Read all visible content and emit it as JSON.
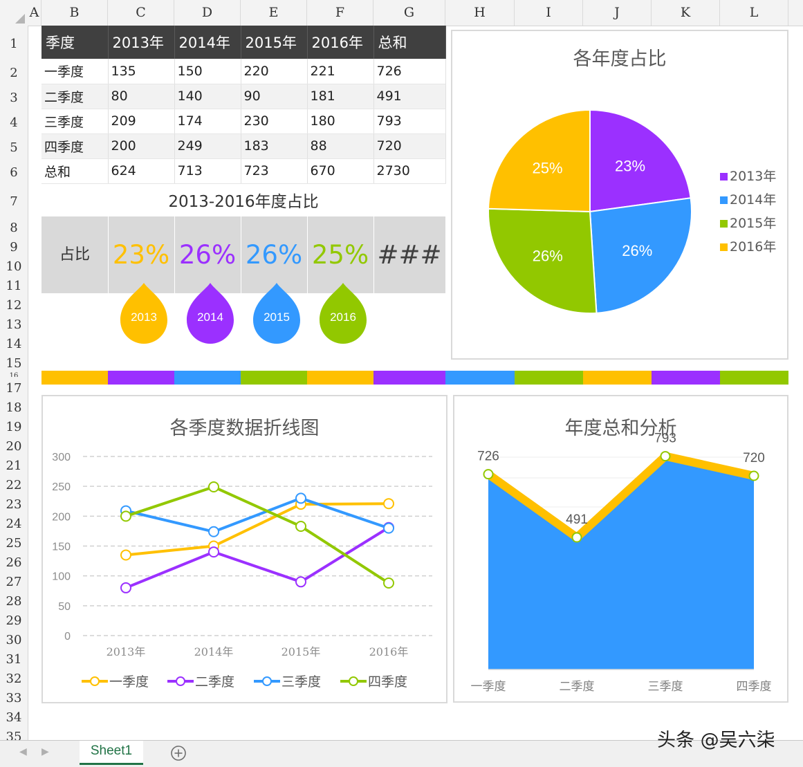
{
  "columns": [
    "A",
    "B",
    "C",
    "D",
    "E",
    "F",
    "G",
    "H",
    "I",
    "J",
    "K",
    "L"
  ],
  "rows": [
    "1",
    "2",
    "3",
    "4",
    "5",
    "6",
    "7",
    "8",
    "9",
    "10",
    "11",
    "12",
    "13",
    "14",
    "15",
    "16",
    "17",
    "18",
    "19",
    "20",
    "21",
    "22",
    "23",
    "24",
    "25",
    "26",
    "27",
    "28",
    "29",
    "30",
    "31",
    "32",
    "33",
    "34",
    "35"
  ],
  "table": {
    "headers": [
      "季度",
      "2013年",
      "2014年",
      "2015年",
      "2016年",
      "总和"
    ],
    "rows": [
      [
        "一季度",
        "135",
        "150",
        "220",
        "221",
        "726"
      ],
      [
        "二季度",
        "80",
        "140",
        "90",
        "181",
        "491"
      ],
      [
        "三季度",
        "209",
        "174",
        "230",
        "180",
        "793"
      ],
      [
        "四季度",
        "200",
        "249",
        "183",
        "88",
        "720"
      ],
      [
        "总和",
        "624",
        "713",
        "723",
        "670",
        "2730"
      ]
    ]
  },
  "ratio": {
    "title": "2013-2016年度占比",
    "label": "占比",
    "values": [
      "23%",
      "26%",
      "26%",
      "25%",
      "###"
    ],
    "colors": [
      "#ffc000",
      "#9b30ff",
      "#3399ff",
      "#92c800",
      "#404040"
    ],
    "drops": [
      {
        "label": "2013",
        "color": "#ffc000"
      },
      {
        "label": "2014",
        "color": "#9b30ff"
      },
      {
        "label": "2015",
        "color": "#3399ff"
      },
      {
        "label": "2016",
        "color": "#92c800"
      }
    ]
  },
  "strip_colors": [
    "#ffc000",
    "#9b30ff",
    "#3399ff",
    "#92c800",
    "#ffc000",
    "#9b30ff",
    "#3399ff",
    "#92c800",
    "#ffc000",
    "#9b30ff",
    "#92c800"
  ],
  "chart_data": [
    {
      "type": "pie",
      "title": "各年度占比",
      "categories": [
        "2013年",
        "2014年",
        "2015年",
        "2016年"
      ],
      "values": [
        624,
        713,
        723,
        670
      ],
      "labels": [
        "23%",
        "26%",
        "26%",
        "25%"
      ],
      "colors": [
        "#9b30ff",
        "#3399ff",
        "#92c800",
        "#ffc000"
      ],
      "legend": "right"
    },
    {
      "type": "line",
      "title": "各季度数据折线图",
      "categories": [
        "2013年",
        "2014年",
        "2015年",
        "2016年"
      ],
      "ylim": [
        0,
        300
      ],
      "yticks": [
        "0",
        "50",
        "100",
        "150",
        "200",
        "250",
        "300"
      ],
      "series": [
        {
          "name": "一季度",
          "values": [
            135,
            150,
            220,
            221
          ],
          "color": "#ffc000"
        },
        {
          "name": "二季度",
          "values": [
            80,
            140,
            90,
            181
          ],
          "color": "#9b30ff"
        },
        {
          "name": "三季度",
          "values": [
            209,
            174,
            230,
            180
          ],
          "color": "#3399ff"
        },
        {
          "name": "四季度",
          "values": [
            200,
            249,
            183,
            88
          ],
          "color": "#92c800"
        }
      ],
      "legend": "bottom",
      "grid": true
    },
    {
      "type": "area",
      "title": "年度总和分析",
      "categories": [
        "一季度",
        "二季度",
        "三季度",
        "四季度"
      ],
      "values": [
        726,
        491,
        793,
        720
      ],
      "labels": [
        "726",
        "491",
        "793",
        "720"
      ],
      "fill_color": "#3399ff",
      "line_color": "#ffc000"
    }
  ],
  "sheet_tab": "Sheet1",
  "add_sheet_icon": "plus-circle-icon",
  "watermark": "头条 @吴六柒"
}
